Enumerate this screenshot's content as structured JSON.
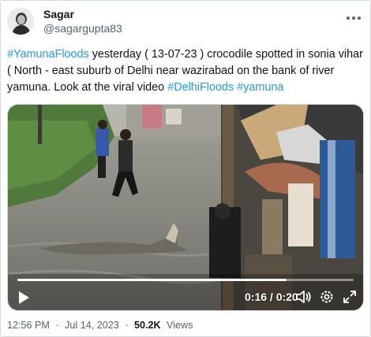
{
  "author": {
    "display_name": "Sagar",
    "handle": "@sagargupta83"
  },
  "tweet": {
    "text_parts": [
      {
        "text": "#YamunaFloods",
        "type": "hashtag"
      },
      {
        "text": " yesterday ( 13-07-23 ) crocodile spotted in sonia vihar ( North - east suburb of Delhi near wazirabad on the bank of river yamuna. Look at the viral video ",
        "type": "text"
      },
      {
        "text": "#DelhiFloods",
        "type": "hashtag"
      },
      {
        "text": " ",
        "type": "text"
      },
      {
        "text": "#yamuna",
        "type": "hashtag"
      }
    ]
  },
  "video": {
    "time_display": "0:16 / 0:20",
    "progress_fraction": 0.8,
    "play_icon": "play-icon",
    "volume_icon": "volume-icon",
    "settings_icon": "gear-icon",
    "fullscreen_icon": "expand-icon"
  },
  "footer": {
    "time": "12:56 PM",
    "separator": "·",
    "date": "Jul 14, 2023",
    "views_count": "50.2K",
    "views_label": "Views"
  },
  "colors": {
    "link": "#1d9bf0",
    "secondary_text": "#536471",
    "primary_text": "#0f1419",
    "border": "#cfd9de"
  }
}
